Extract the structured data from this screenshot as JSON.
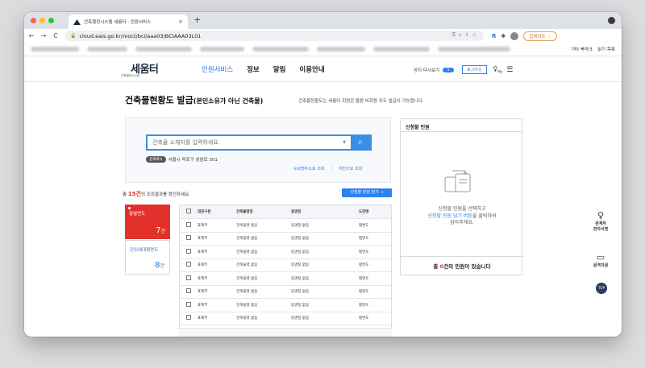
{
  "browser": {
    "tab_title": "건축행정시스템 세움터 - 민원서비스",
    "tab_close": "×",
    "new_tab": "+",
    "url": "cloud.eais.go.kr/moct/bci/aaa03/BCIAAA03L01",
    "update_label": "업데이트 ⋮",
    "bookmarks_other": "기타 북마크",
    "bookmarks_reading": "읽기 목록"
  },
  "header": {
    "logo_text": "세움터",
    "logo_sub": "건축행정시스템",
    "nav": [
      "민원서비스",
      "정보",
      "알림",
      "이용안내"
    ],
    "notice_label": "공지 다시보기",
    "notice_count": "5",
    "logout_label": "로그아웃",
    "my_label": "My"
  },
  "page": {
    "title": "건축물현황도 발급",
    "title_sub": "(본인소유가 아닌 건축물)",
    "desc": "건축물현황도는 세움터 회원은 물론 비회원 모두 발급이 가능합니다."
  },
  "search": {
    "placeholder": "건축물 소재지를 입력하세요.",
    "example_badge": "검색예시",
    "example_text": "서울시 마포구 성암로 301",
    "link_road": "도로명주소로 조회",
    "link_lot": "지번으로 조회"
  },
  "results": {
    "prefix": "총",
    "count": "15건",
    "suffix": "의 조회결과를 확인하세요.",
    "add_button": "신청할 민원 담기 →"
  },
  "cards": {
    "first_label": "층별면도",
    "first_value": "7",
    "first_unit": "건",
    "second_label": "단위세대평면도",
    "second_value": "8",
    "second_unit": "건"
  },
  "table": {
    "headers": [
      "대장구분",
      "건축물명칭",
      "동명칭",
      "도면명"
    ],
    "rows": [
      [
        "표제부",
        "건축물명 없음",
        "동명칭 없음",
        "평면도"
      ],
      [
        "표제부",
        "건축물명 없음",
        "동명칭 없음",
        "평면도"
      ],
      [
        "표제부",
        "건축물명 없음",
        "동명칭 없음",
        "평면도"
      ],
      [
        "표제부",
        "건축물명 없음",
        "동명칭 없음",
        "평면도"
      ],
      [
        "표제부",
        "건축물명 없음",
        "동명칭 없음",
        "평면도"
      ],
      [
        "표제부",
        "건축물명 없음",
        "동명칭 없음",
        "평면도"
      ],
      [
        "표제부",
        "건축물명 없음",
        "동명칭 없음",
        "평면도"
      ],
      [
        "표제부",
        "건축물명 없음",
        "동명칭 없음",
        "평면도"
      ]
    ]
  },
  "apply": {
    "title": "신청할 민원",
    "msg_line1": "신청할 민원을 선택하고",
    "msg_highlight": "신청할 민원 담기 버튼",
    "msg_line2_suffix": "을 클릭하여",
    "msg_line3": "담아주세요.",
    "foot_prefix": "총",
    "foot_count": "0",
    "foot_suffix": "건의 민원이 있습니다"
  },
  "side_tools": {
    "signer_label1": "관계자",
    "signer_label2": "전자서명",
    "remote_label": "원격지원",
    "top_label": "TOP"
  },
  "colors": {
    "accent_blue": "#2f80ed",
    "accent_red": "#e2312a"
  }
}
